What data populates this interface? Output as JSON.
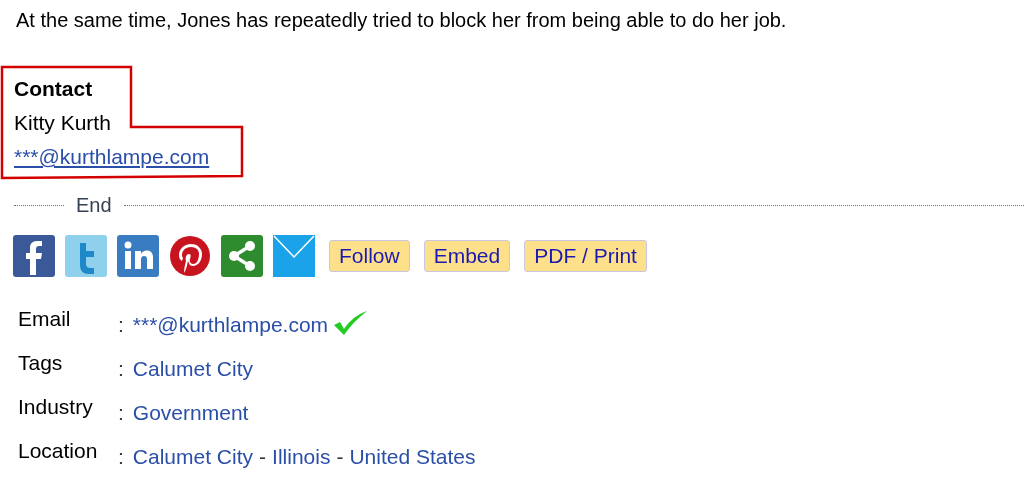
{
  "paragraph": "At the same time, Jones has repeatedly tried to block her from being able to do her job.",
  "contact": {
    "heading": "Contact",
    "name": "Kitty Kurth",
    "email": "***@kurthlampe.com",
    "highlighted": true
  },
  "divider_label": "End",
  "share_icons": [
    {
      "kind": "facebook"
    },
    {
      "kind": "twitter"
    },
    {
      "kind": "linkedin"
    },
    {
      "kind": "pinterest"
    },
    {
      "kind": "share"
    },
    {
      "kind": "email"
    }
  ],
  "buttons": [
    "Follow",
    "Embed",
    "PDF / Print"
  ],
  "details": [
    {
      "label": "Email",
      "separator": ":",
      "values": [
        "***@kurthlampe.com"
      ],
      "verified": true
    },
    {
      "label": "Tags",
      "separator": ":",
      "values": [
        "Calumet City"
      ],
      "verified": false
    },
    {
      "label": "Industry",
      "separator": ":",
      "values": [
        "Government"
      ],
      "verified": false
    },
    {
      "label": "Location",
      "separator": ":",
      "values": [
        "Calumet City",
        "Illinois",
        "United States"
      ],
      "joiner": "-",
      "verified": false
    }
  ]
}
